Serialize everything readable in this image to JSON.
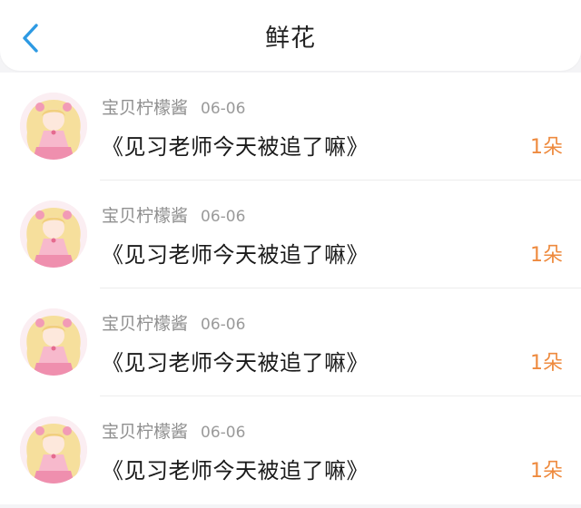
{
  "header": {
    "title": "鲜花",
    "back_icon": "chevron-left-icon",
    "accent_color": "#2d9ae3"
  },
  "items": [
    {
      "user": "宝贝柠檬酱",
      "date": "06-06",
      "book": "《见习老师今天被追了嘛》",
      "amount": "1朵"
    },
    {
      "user": "宝贝柠檬酱",
      "date": "06-06",
      "book": "《见习老师今天被追了嘛》",
      "amount": "1朵"
    },
    {
      "user": "宝贝柠檬酱",
      "date": "06-06",
      "book": "《见习老师今天被追了嘛》",
      "amount": "1朵"
    },
    {
      "user": "宝贝柠檬酱",
      "date": "06-06",
      "book": "《见习老师今天被追了嘛》",
      "amount": "1朵"
    }
  ],
  "colors": {
    "amount": "#ee8a3e"
  }
}
